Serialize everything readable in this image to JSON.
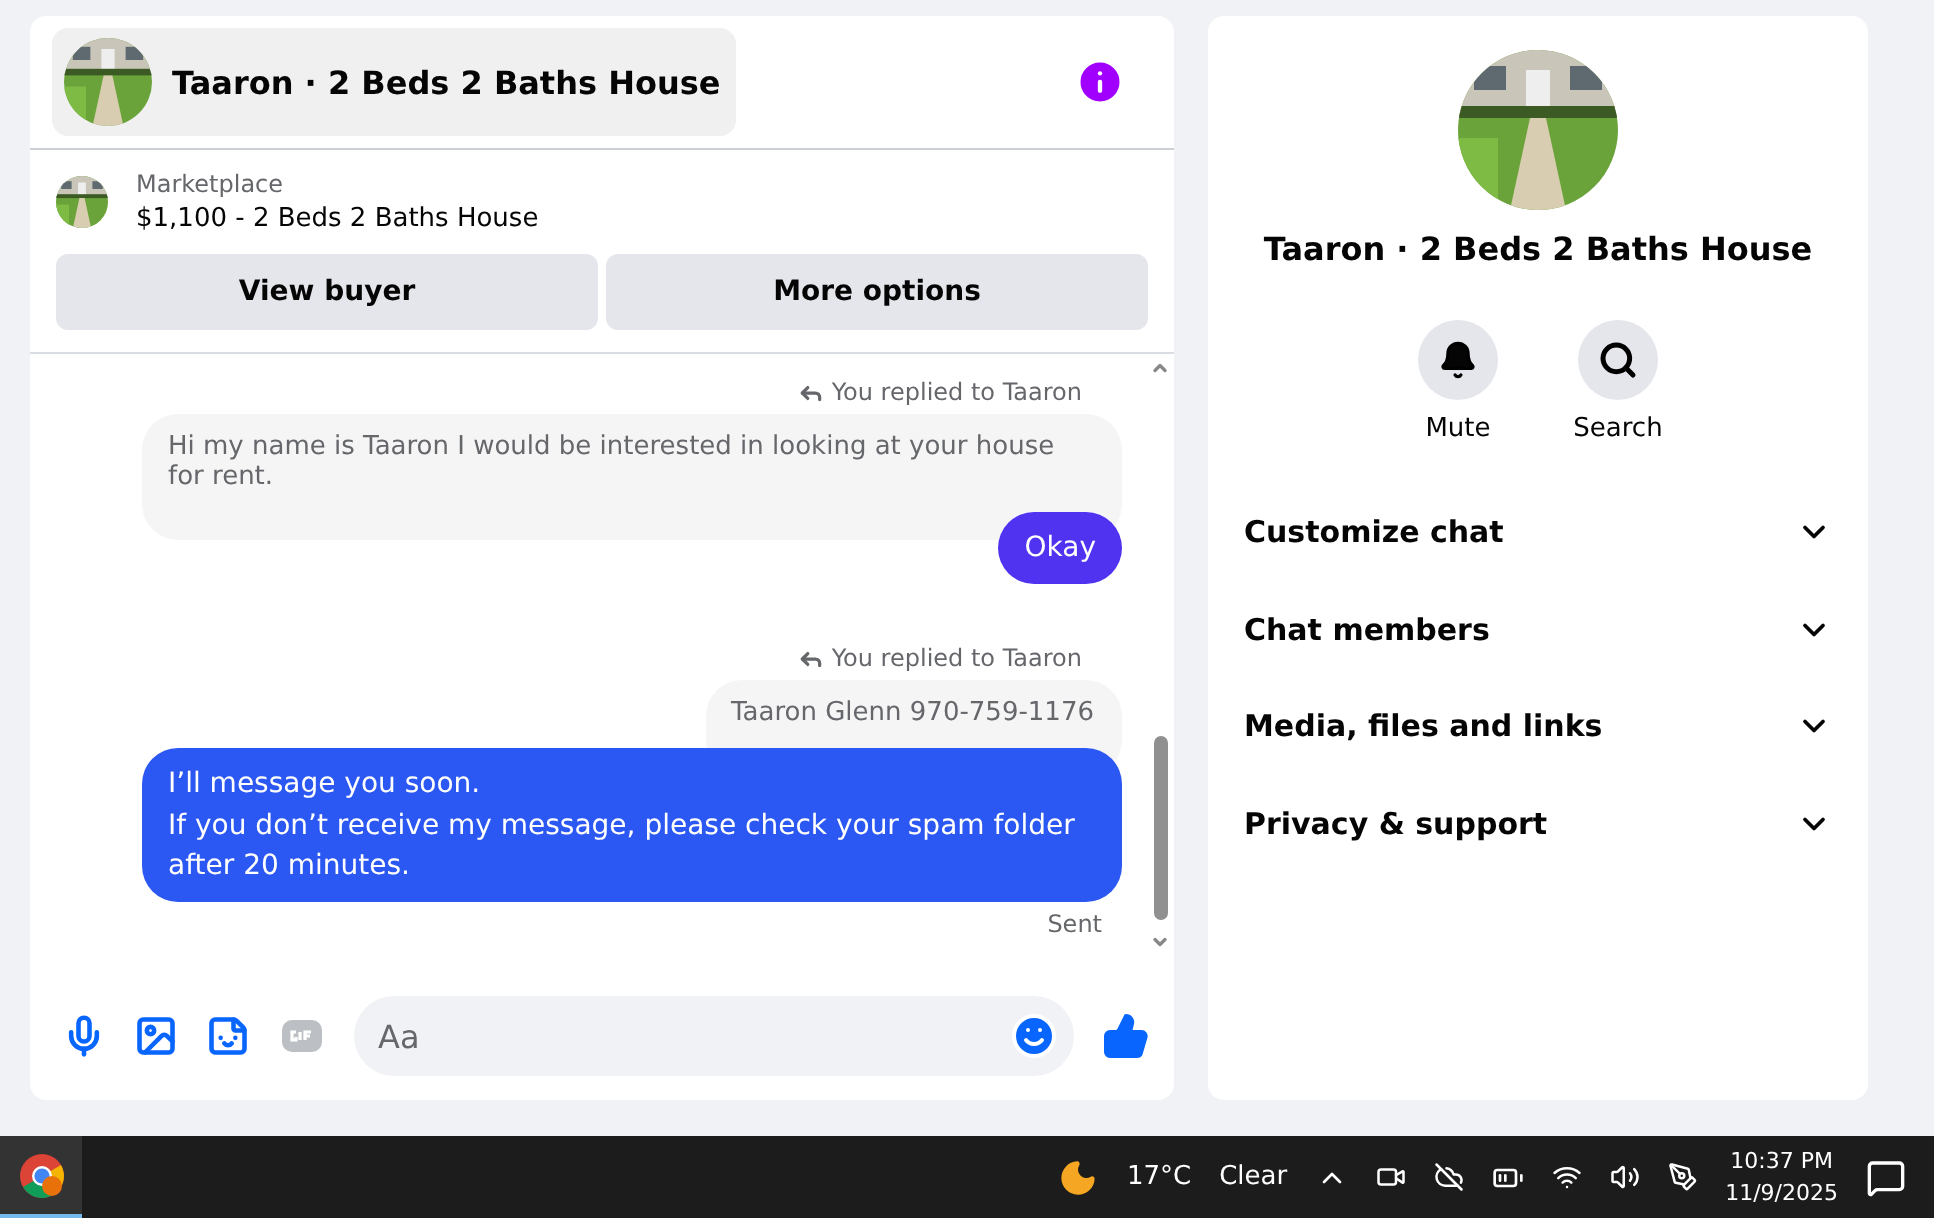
{
  "chat": {
    "title": "Taaron · 2 Beds 2 Baths House"
  },
  "listing": {
    "source": "Marketplace",
    "summary": "$1,100 - 2 Beds 2 Baths House"
  },
  "actions": [
    "View buyer",
    "More options"
  ],
  "messages": [
    {
      "kind": "reply_note",
      "text": "You replied to Taaron"
    },
    {
      "kind": "quoted",
      "text": "Hi my name is Taaron I would be interested in looking at your house for rent."
    },
    {
      "kind": "sent",
      "text": "Okay",
      "color": "#5033f0"
    },
    {
      "kind": "reply_note",
      "text": "You replied to Taaron"
    },
    {
      "kind": "quoted",
      "text": "Taaron Glenn 970-759-1176"
    },
    {
      "kind": "sent",
      "text": "I’ll message you soon.\nIf you don’t receive my message, please check your spam folder after 20 minutes.",
      "color": "#2b57f2"
    },
    {
      "kind": "status",
      "text": "Sent"
    }
  ],
  "composer": {
    "placeholder": "Aa"
  },
  "details": {
    "title": "Taaron · 2 Beds 2 Baths House",
    "actions": [
      {
        "kind": "mute",
        "label": "Mute"
      },
      {
        "kind": "search",
        "label": "Search"
      }
    ],
    "sections": [
      {
        "label": "Customize chat",
        "expanded": false
      },
      {
        "label": "Chat members",
        "expanded": false
      },
      {
        "label": "Media, files and links",
        "expanded": false
      },
      {
        "label": "Privacy & support",
        "expanded": false
      }
    ]
  },
  "taskbar": {
    "temperature": "17°C",
    "weather": "Clear",
    "time": "10:37 PM",
    "date": "11/9/2025"
  }
}
